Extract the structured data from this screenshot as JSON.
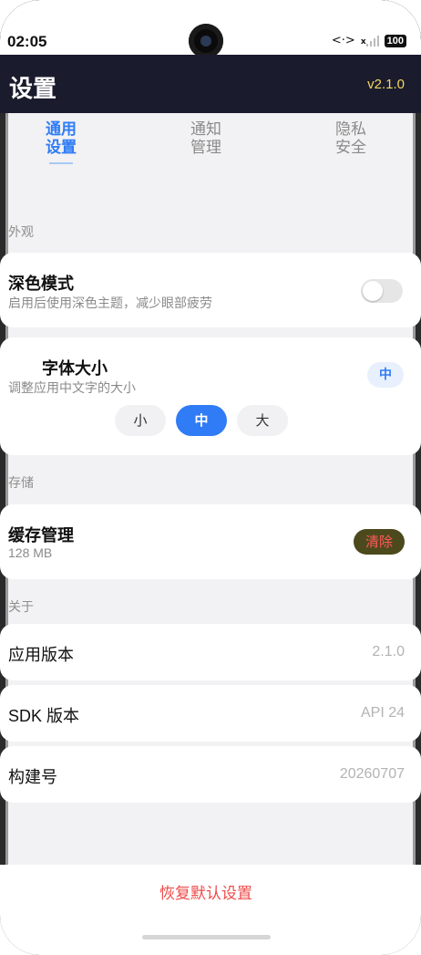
{
  "status_bar": {
    "time": "02:05",
    "network_icon": "<·>",
    "signal_mark": "x",
    "battery": "100"
  },
  "header": {
    "title": "设置",
    "version": "v2.1.0"
  },
  "tabs": [
    {
      "label": "通用设置",
      "line1": "通用",
      "line2": "设置",
      "active": true
    },
    {
      "label": "通知管理",
      "line1": "通知",
      "line2": "管理",
      "active": false
    },
    {
      "label": "隐私安全",
      "line1": "隐私",
      "line2": "安全",
      "active": false
    }
  ],
  "sections": {
    "appearance": "外观",
    "storage": "存储",
    "about": "关于"
  },
  "dark_mode": {
    "title": "深色模式",
    "subtitle": "启用后使用深色主题，减少眼部疲劳",
    "enabled": false
  },
  "font_size": {
    "title": "字体大小",
    "subtitle": "调整应用中文字的大小",
    "badge": "中",
    "options": [
      "小",
      "中",
      "大"
    ],
    "selected": "中"
  },
  "cache": {
    "title": "缓存管理",
    "size": "128 MB",
    "clear_label": "清除"
  },
  "about": {
    "app_version_label": "应用版本",
    "app_version_value": "2.1.0",
    "sdk_label": "SDK 版本",
    "sdk_value": "API 24",
    "build_label": "构建号",
    "build_value": "20260707"
  },
  "reset_label": "恢复默认设置",
  "colors": {
    "accent": "#2f7cf6",
    "header_bg": "#1b1b2e",
    "version_text": "#f2d75c",
    "danger": "#ef4b4b"
  }
}
